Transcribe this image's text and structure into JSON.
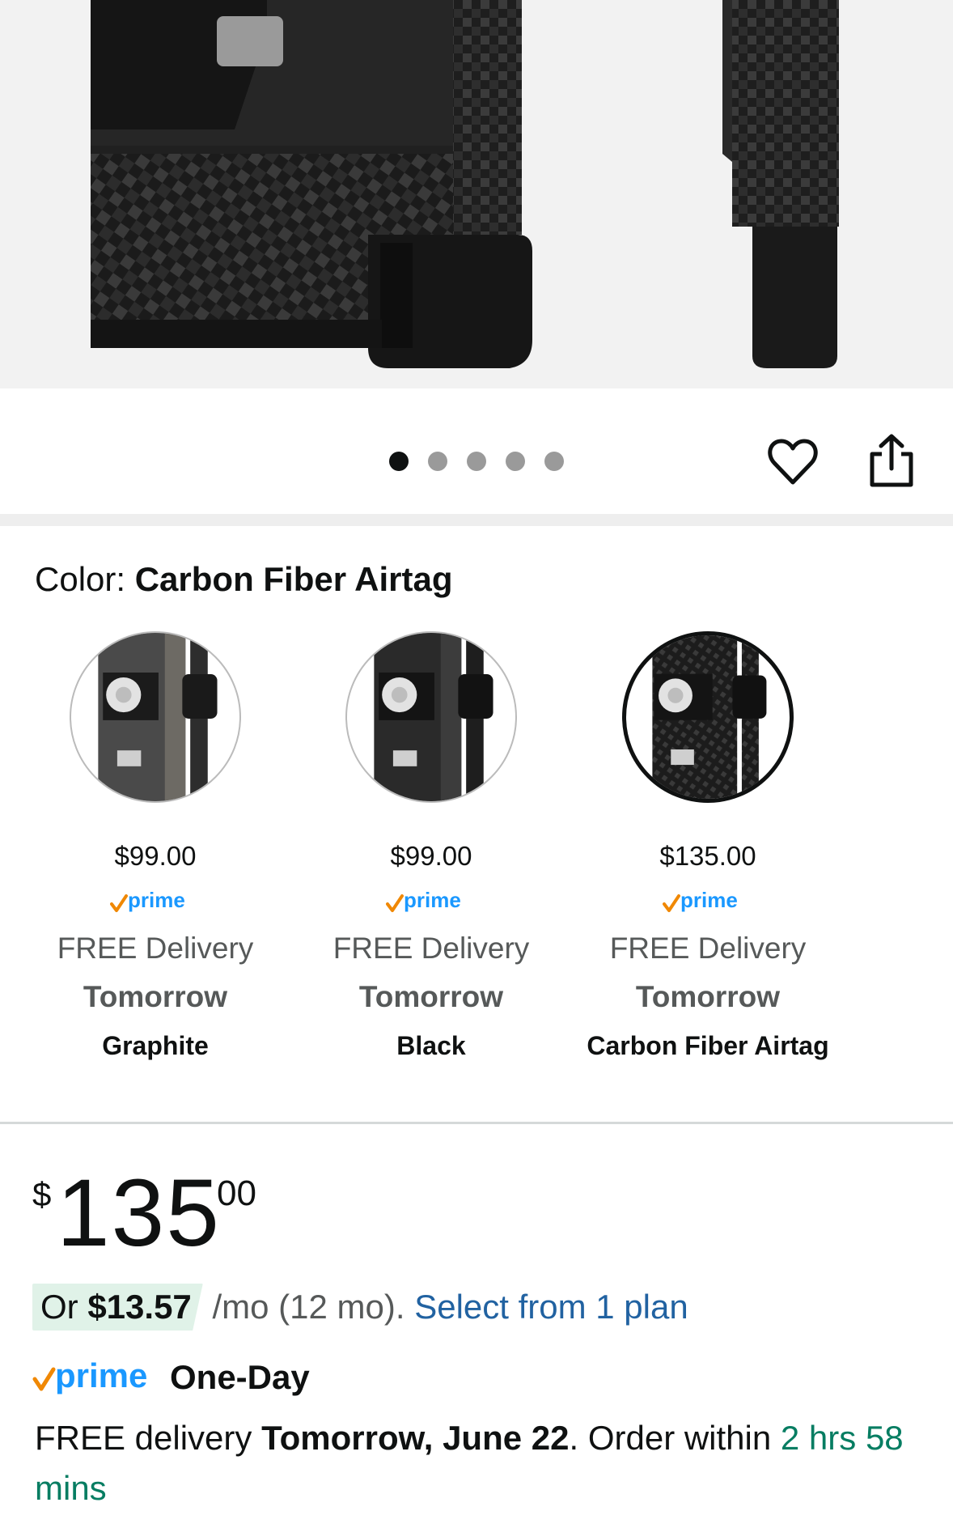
{
  "gallery": {
    "dot_count": 5,
    "active_dot": 0
  },
  "color": {
    "label": "Color:",
    "selected": "Carbon Fiber Airtag"
  },
  "swatches": [
    {
      "price": "$99.00",
      "delivery": "FREE Delivery",
      "when": "Tomorrow",
      "name": "Graphite",
      "selected": false
    },
    {
      "price": "$99.00",
      "delivery": "FREE Delivery",
      "when": "Tomorrow",
      "name": "Black",
      "selected": false
    },
    {
      "price": "$135.00",
      "delivery": "FREE Delivery",
      "when": "Tomorrow",
      "name": "Carbon Fiber Airtag",
      "selected": true
    }
  ],
  "price": {
    "currency": "$",
    "whole": "135",
    "fraction": "00"
  },
  "installment": {
    "prefix": "Or",
    "amount": "$13.57",
    "terms": "/mo (12 mo).",
    "link": "Select from 1 plan"
  },
  "prime": {
    "badge": "prime",
    "label": "One-Day"
  },
  "delivery": {
    "prefix": "FREE delivery",
    "date": "Tomorrow, June 22",
    "middle": ". Order within",
    "countdown": "2 hrs 58 mins"
  },
  "colors": {
    "link": "#2162a1",
    "green": "#067d62",
    "prime_blue": "#1a98ff",
    "prime_check": "#f08804",
    "installment_bg": "#e0f2e8"
  },
  "icons": {
    "wishlist": "heart-outline-icon",
    "share": "share-icon"
  }
}
